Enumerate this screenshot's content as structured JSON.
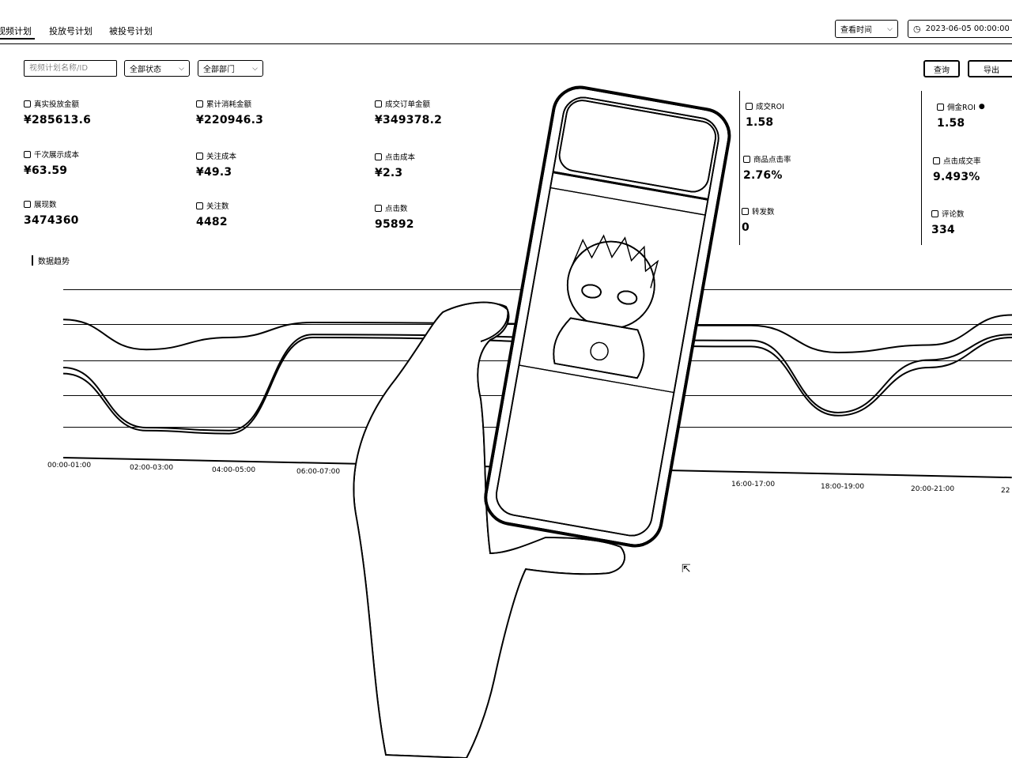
{
  "tabs": [
    "视频计划",
    "投放号计划",
    "被投号计划"
  ],
  "header": {
    "time_filter_label": "查看时间",
    "date_value": "2023-06-05 00:00:00"
  },
  "filters": {
    "search_placeholder": "视频计划名称/ID",
    "status_label": "全部状态",
    "department_label": "全部部门"
  },
  "actions": {
    "query_label": "查询",
    "export_label": "导出"
  },
  "metrics_left": [
    {
      "label": "真实投放金额",
      "value": "¥285613.6"
    },
    {
      "label": "累计消耗金额",
      "value": "¥220946.3"
    },
    {
      "label": "成交订单金额",
      "value": "¥349378.2"
    },
    {
      "label": "千次展示成本",
      "value": "¥63.59"
    },
    {
      "label": "关注成本",
      "value": "¥49.3"
    },
    {
      "label": "点击成本",
      "value": "¥2.3"
    },
    {
      "label": "展现数",
      "value": "3474360"
    },
    {
      "label": "关注数",
      "value": "4482"
    },
    {
      "label": "点击数",
      "value": "95892"
    }
  ],
  "metrics_right": [
    {
      "label": "成交ROI",
      "value": "1.58"
    },
    {
      "label": "佣金ROI",
      "value": "1.58"
    },
    {
      "label": "商品点击率",
      "value": "2.76%"
    },
    {
      "label": "点击成交率",
      "value": "9.493%"
    },
    {
      "label": "转发数",
      "value": "0"
    },
    {
      "label": "评论数",
      "value": "334"
    }
  ],
  "section_title": "数据趋势",
  "chart_data": {
    "type": "line",
    "categories": [
      "00:00-01:00",
      "02:00-03:00",
      "04:00-05:00",
      "06:00-07:00",
      "16:00-17:00",
      "18:00-19:00",
      "20:00-21:00",
      "22"
    ],
    "series": [
      {
        "values": [
          0.82,
          0.62,
          0.7,
          0.8,
          0.78,
          0.6,
          0.65,
          0.85
        ]
      },
      {
        "values": [
          0.5,
          0.1,
          0.08,
          0.72,
          0.68,
          0.2,
          0.55,
          0.72
        ]
      },
      {
        "values": [
          0.46,
          0.08,
          0.06,
          0.7,
          0.64,
          0.18,
          0.5,
          0.7
        ]
      }
    ]
  },
  "icons": {
    "calendar": "calendar-icon",
    "chevron": "chevron-down-icon",
    "info": "info-icon"
  }
}
